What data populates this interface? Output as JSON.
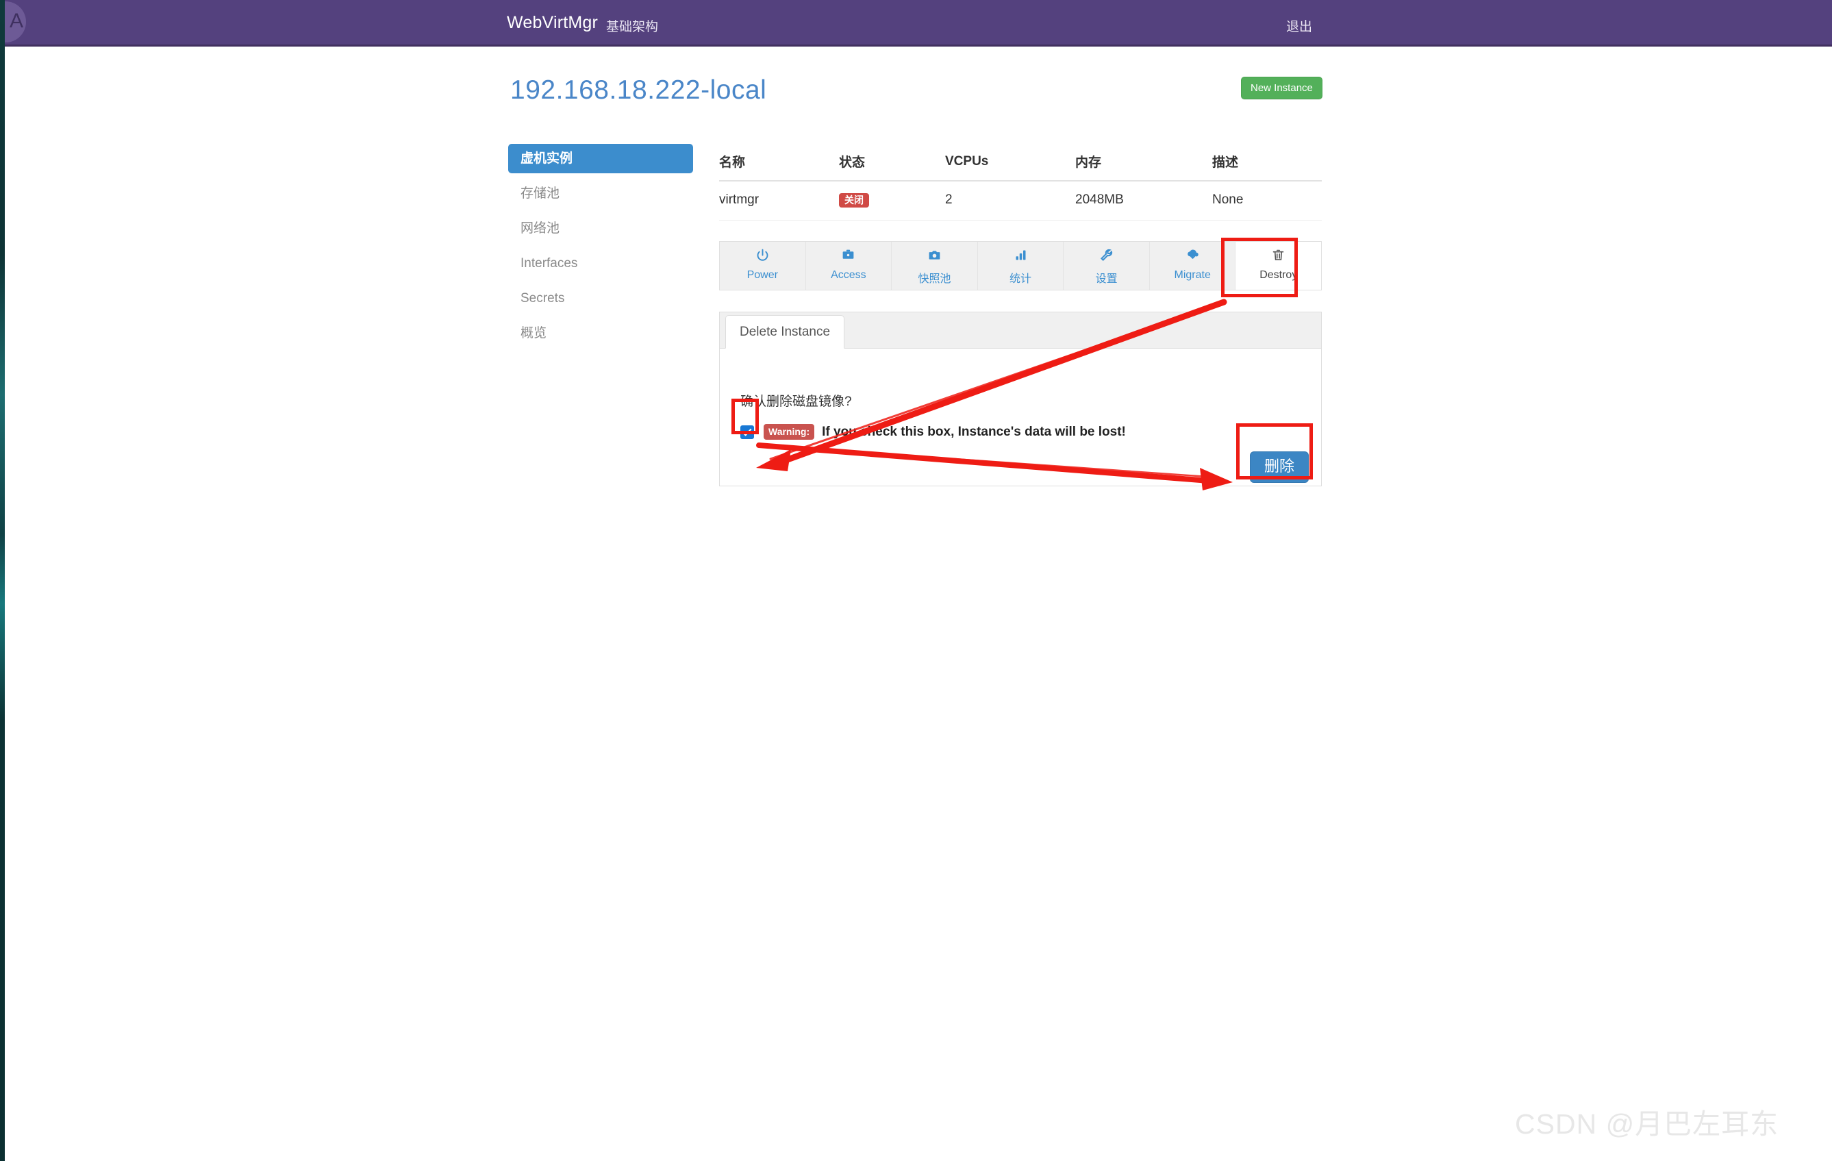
{
  "navbar": {
    "brand": "WebVirtMgr",
    "infrastructure": "基础架构",
    "logout": "退出",
    "avatar_letter": "A",
    "background_color": "#54417e"
  },
  "header": {
    "title": "192.168.18.222-local",
    "title_color": "#4a86c8",
    "new_instance_label": "New Instance",
    "new_instance_color": "#53b05a"
  },
  "sidebar": {
    "items": [
      {
        "label": "虚机实例",
        "active": true
      },
      {
        "label": "存储池",
        "active": false
      },
      {
        "label": "网络池",
        "active": false
      },
      {
        "label": "Interfaces",
        "active": false
      },
      {
        "label": "Secrets",
        "active": false
      },
      {
        "label": "概览",
        "active": false
      }
    ],
    "active_color": "#3c8dcd"
  },
  "instances_table": {
    "columns": [
      "名称",
      "状态",
      "VCPUs",
      "内存",
      "描述"
    ],
    "rows": [
      {
        "name": "virtmgr",
        "state": "关闭",
        "state_color": "#d04a45",
        "vcpus": "2",
        "memory": "2048MB",
        "description": "None"
      }
    ]
  },
  "action_tabs": [
    {
      "label": "Power",
      "icon": "power-icon",
      "glyph": "⏻",
      "active": false
    },
    {
      "label": "Access",
      "icon": "console-icon",
      "glyph": "🖥",
      "active": false
    },
    {
      "label": "快照池",
      "icon": "camera-icon",
      "glyph": "📷",
      "active": false
    },
    {
      "label": "统计",
      "icon": "chart-icon",
      "glyph": "📶",
      "active": false
    },
    {
      "label": "设置",
      "icon": "wrench-icon",
      "glyph": "🔧",
      "active": false
    },
    {
      "label": "Migrate",
      "icon": "migrate-icon",
      "glyph": "⬇",
      "active": false
    },
    {
      "label": "Destroy",
      "icon": "trash-icon",
      "glyph": "🗑",
      "active": true
    }
  ],
  "panel": {
    "tab_label": "Delete Instance",
    "confirm_text": "确认删除磁盘镜像?",
    "checkbox_checked": true,
    "warning_badge": "Warning:",
    "warning_text": "If you check this box, Instance's data will be lost!",
    "delete_button_label": "删除",
    "delete_button_color": "#3c86c4"
  },
  "annotations": {
    "highlight_color": "#ee1c14",
    "boxes": [
      "destroy-tab",
      "delete-checkbox",
      "delete-button"
    ],
    "arrows": [
      "destroy-tab-to-checkbox",
      "checkbox-to-delete-button"
    ]
  },
  "watermark": {
    "text": "CSDN @月巴左耳东"
  }
}
